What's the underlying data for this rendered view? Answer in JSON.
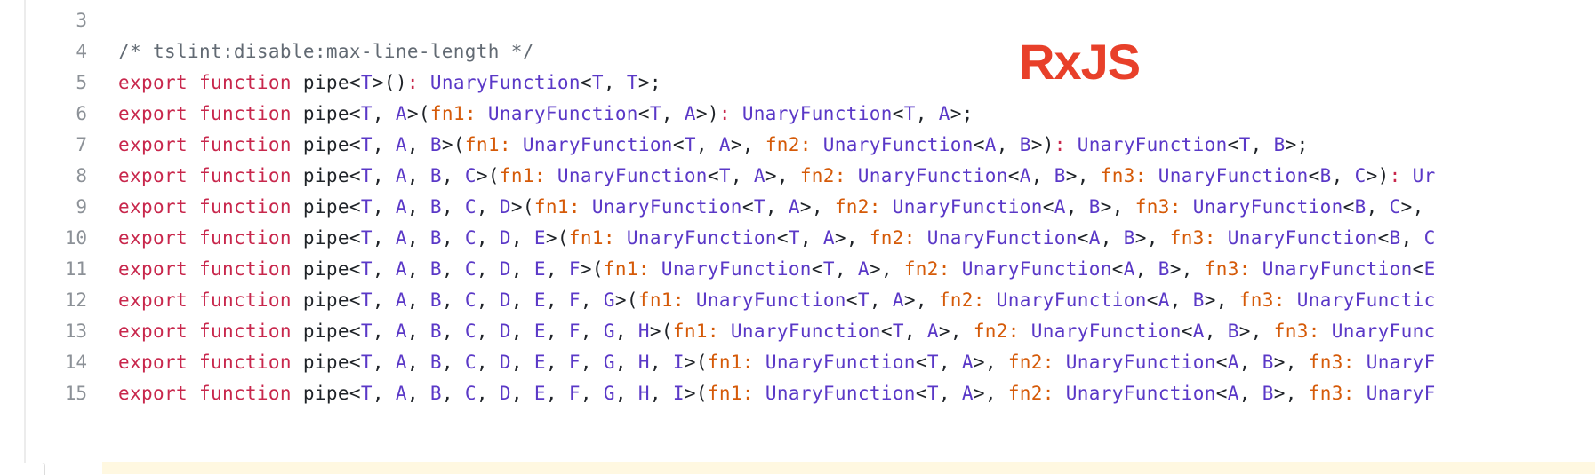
{
  "logo": {
    "text": "RxJS"
  },
  "colors": {
    "keyword": "#c8274c",
    "type": "#5a38c7",
    "param": "#d55a08",
    "plain": "#1f2328",
    "comment": "#626a73",
    "line_number": "#8c9197",
    "logo": "#e8402a"
  },
  "code_lines": [
    {
      "number": "3",
      "text": ""
    },
    {
      "number": "4",
      "text": "/* tslint:disable:max-line-length */"
    },
    {
      "number": "5",
      "text": "export function pipe<T>(): UnaryFunction<T, T>;"
    },
    {
      "number": "6",
      "text": "export function pipe<T, A>(fn1: UnaryFunction<T, A>): UnaryFunction<T, A>;"
    },
    {
      "number": "7",
      "text": "export function pipe<T, A, B>(fn1: UnaryFunction<T, A>, fn2: UnaryFunction<A, B>): UnaryFunction<T, B>;"
    },
    {
      "number": "8",
      "text": "export function pipe<T, A, B, C>(fn1: UnaryFunction<T, A>, fn2: UnaryFunction<A, B>, fn3: UnaryFunction<B, C>): Ur"
    },
    {
      "number": "9",
      "text": "export function pipe<T, A, B, C, D>(fn1: UnaryFunction<T, A>, fn2: UnaryFunction<A, B>, fn3: UnaryFunction<B, C>,"
    },
    {
      "number": "10",
      "text": "export function pipe<T, A, B, C, D, E>(fn1: UnaryFunction<T, A>, fn2: UnaryFunction<A, B>, fn3: UnaryFunction<B, C"
    },
    {
      "number": "11",
      "text": "export function pipe<T, A, B, C, D, E, F>(fn1: UnaryFunction<T, A>, fn2: UnaryFunction<A, B>, fn3: UnaryFunction<E"
    },
    {
      "number": "12",
      "text": "export function pipe<T, A, B, C, D, E, F, G>(fn1: UnaryFunction<T, A>, fn2: UnaryFunction<A, B>, fn3: UnaryFunctic"
    },
    {
      "number": "13",
      "text": "export function pipe<T, A, B, C, D, E, F, G, H>(fn1: UnaryFunction<T, A>, fn2: UnaryFunction<A, B>, fn3: UnaryFunc"
    },
    {
      "number": "14",
      "text": "export function pipe<T, A, B, C, D, E, F, G, H, I>(fn1: UnaryFunction<T, A>, fn2: UnaryFunction<A, B>, fn3: UnaryF"
    },
    {
      "number": "15",
      "text": "export function pipe<T, A, B, C, D, E, F, G, H, I>(fn1: UnaryFunction<T, A>, fn2: UnaryFunction<A, B>, fn3: UnaryF"
    }
  ]
}
